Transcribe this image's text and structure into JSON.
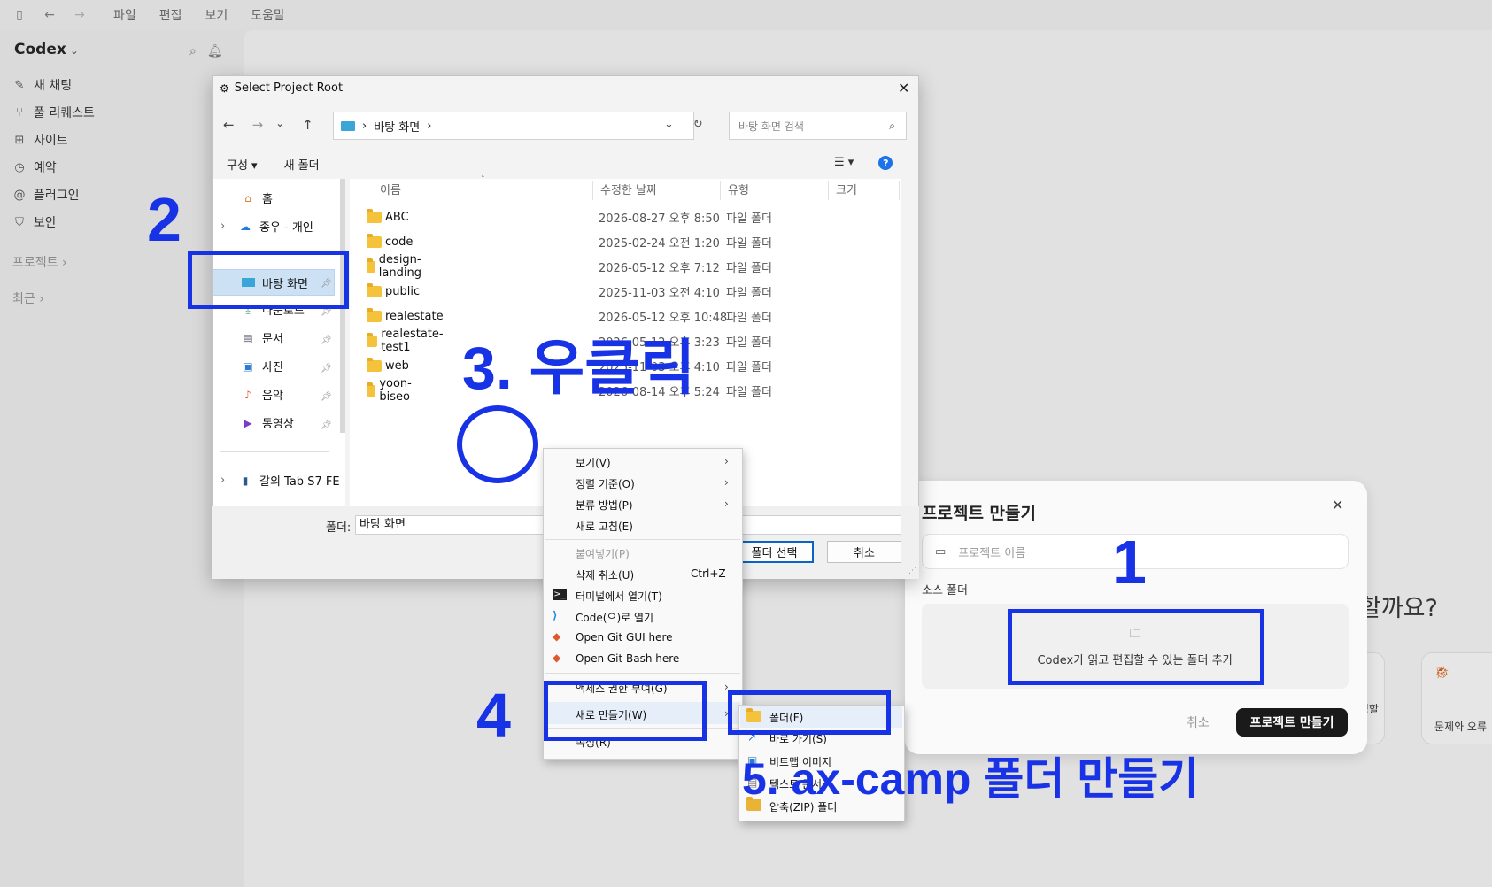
{
  "menubar": {
    "items": [
      "파일",
      "편집",
      "보기",
      "도움말"
    ]
  },
  "sidebar": {
    "brand": "Codex",
    "nav": [
      {
        "icon": "pencil-icon",
        "label": "새 채팅"
      },
      {
        "icon": "pull-request-icon",
        "label": "풀 리퀘스트"
      },
      {
        "icon": "sites-icon",
        "label": "사이트"
      },
      {
        "icon": "clock-icon",
        "label": "예약"
      },
      {
        "icon": "plugin-icon",
        "label": "플러그인"
      },
      {
        "icon": "shield-icon",
        "label": "보안"
      }
    ],
    "projects": "프로젝트",
    "recent": "최근"
  },
  "main": {
    "ask_fragment": "할까요?",
    "card_a": "·정할",
    "card_b": "문제와 오류"
  },
  "project_panel": {
    "title": "프로젝트 만들기",
    "name_placeholder": "프로젝트 이름",
    "source_label": "소스 폴더",
    "drop_text": "Codex가 읽고 편집할 수 있는 폴더 추가",
    "cancel": "취소",
    "create": "프로젝트 만들기"
  },
  "dialog": {
    "title": "Select Project Root",
    "path": "바탕 화면",
    "search_placeholder": "바탕 화면 검색",
    "toolbar": {
      "organize": "구성",
      "new_folder": "새 폴더"
    },
    "tree": [
      {
        "label": "홈",
        "pinned": false
      },
      {
        "label": "종우 - 개인",
        "pinned": false
      },
      {
        "label": "바탕 화면",
        "pinned": true
      },
      {
        "label": "다운로드",
        "pinned": true
      },
      {
        "label": "문서",
        "pinned": true
      },
      {
        "label": "사진",
        "pinned": true
      },
      {
        "label": "음악",
        "pinned": true
      },
      {
        "label": "동영상",
        "pinned": true
      },
      {
        "label": "갈의 Tab S7 FE",
        "pinned": false
      }
    ],
    "columns": [
      "이름",
      "수정한 날짜",
      "유형",
      "크기"
    ],
    "files": [
      {
        "name": "ABC",
        "date": "2026-08-27 오후 8:50",
        "type": "파일 폴더"
      },
      {
        "name": "code",
        "date": "2025-02-24 오전 1:20",
        "type": "파일 폴더"
      },
      {
        "name": "design-landing",
        "date": "2026-05-12 오후 7:12",
        "type": "파일 폴더"
      },
      {
        "name": "public",
        "date": "2025-11-03 오전 4:10",
        "type": "파일 폴더"
      },
      {
        "name": "realestate",
        "date": "2026-05-12 오후 10:48",
        "type": "파일 폴더"
      },
      {
        "name": "realestate-test1",
        "date": "2026-05-12 오후 3:23",
        "type": "파일 폴더"
      },
      {
        "name": "web",
        "date": "2025-11-03 오후 4:10",
        "type": "파일 폴더"
      },
      {
        "name": "yoon-biseo",
        "date": "2026-08-14 오후 5:24",
        "type": "파일 폴더"
      }
    ],
    "folder_label": "폴더:",
    "folder_value": "바탕 화면",
    "select_btn": "폴더 선택",
    "cancel_btn": "취소"
  },
  "context_menu": {
    "items": [
      {
        "label": "보기(V)",
        "arrow": true
      },
      {
        "label": "정렬 기준(O)",
        "arrow": true
      },
      {
        "label": "분류 방법(P)",
        "arrow": true
      },
      {
        "label": "새로 고침(E)"
      },
      {
        "label": "붙여넣기(P)",
        "disabled": true
      },
      {
        "label": "삭제 취소(U)",
        "shortcut": "Ctrl+Z"
      },
      {
        "label": "터미널에서 열기(T)",
        "icon": "terminal-icon"
      },
      {
        "label": "Code(으)로 열기",
        "icon": "vscode-icon"
      },
      {
        "label": "Open Git GUI here",
        "icon": "git-icon"
      },
      {
        "label": "Open Git Bash here",
        "icon": "git-icon"
      },
      {
        "label": "액세스 권한 부여(G)",
        "arrow": true
      },
      {
        "label": "새로 만들기(W)",
        "arrow": true
      },
      {
        "label": "속성(R)"
      }
    ],
    "submenu": [
      {
        "label": "폴더(F)"
      },
      {
        "label": "바로 가기(S)"
      },
      {
        "label": "비트맵 이미지"
      },
      {
        "label": "텍스트 문서"
      },
      {
        "label": "압축(ZIP) 폴더"
      }
    ]
  },
  "annotations": {
    "step1": "1",
    "step2": "2",
    "step3": "3. 우클릭",
    "step4": "4",
    "step5": "5. ax-camp 폴더 만들기",
    "color": "#1832e5"
  }
}
